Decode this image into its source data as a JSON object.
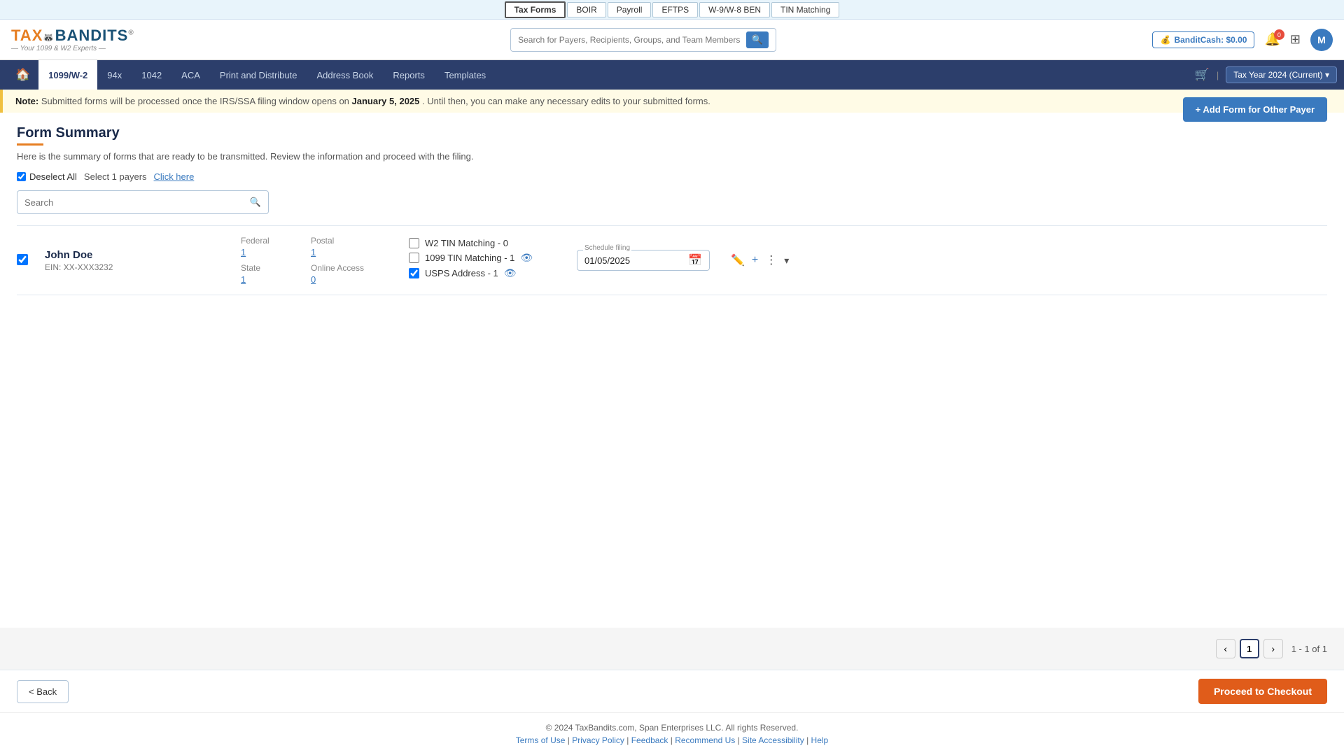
{
  "topbar": {
    "items": [
      {
        "label": "Tax Forms",
        "active": true
      },
      {
        "label": "BOIR",
        "active": false
      },
      {
        "label": "Payroll",
        "active": false
      },
      {
        "label": "EFTPS",
        "active": false
      },
      {
        "label": "W-9/W-8 BEN",
        "active": false
      },
      {
        "label": "TIN Matching",
        "active": false
      }
    ]
  },
  "header": {
    "logo_main": "TAX",
    "logo_brand": "BANDITS",
    "logo_icon": "🦝",
    "logo_reg": "®",
    "logo_sub": "— Your 1099 & W2 Experts —",
    "search_placeholder": "Search for Payers, Recipients, Groups, and Team Members",
    "bandit_cash": "BanditCash: $0.00",
    "notif_count": "0",
    "avatar_label": "M"
  },
  "nav": {
    "items": [
      {
        "label": "1099/W-2",
        "active": true
      },
      {
        "label": "94x",
        "active": false
      },
      {
        "label": "1042",
        "active": false
      },
      {
        "label": "ACA",
        "active": false
      },
      {
        "label": "Print and Distribute",
        "active": false
      },
      {
        "label": "Address Book",
        "active": false
      },
      {
        "label": "Reports",
        "active": false
      },
      {
        "label": "Templates",
        "active": false
      }
    ],
    "tax_year": "Tax Year 2024 (Current) ▾"
  },
  "note": {
    "prefix": "Note:",
    "text": " Submitted forms will be processed once the IRS/SSA filing window opens on ",
    "date": "January 5, 2025",
    "suffix": ". Until then, you can make any necessary edits to your submitted forms."
  },
  "page": {
    "title": "Form Summary",
    "subtitle": "Here is the summary of forms that are ready to be transmitted. Review the information and proceed with the filing.",
    "add_btn": "+ Add Form for Other Payer",
    "deselect_all": "Deselect All",
    "select_payers_text": "Select 1 payers",
    "click_here": "Click here",
    "search_placeholder": "Search"
  },
  "payers": [
    {
      "name": "John Doe",
      "ein": "EIN: XX-XXX3232",
      "federal_label": "Federal",
      "federal_count": "1",
      "state_label": "State",
      "state_count": "1",
      "postal_label": "Postal",
      "postal_count": "1",
      "online_label": "Online Access",
      "online_count": "0",
      "w2_tin_label": "W2 TIN Matching - 0",
      "w2_tin_checked": false,
      "tin1099_label": "1099 TIN Matching - 1",
      "tin1099_checked": false,
      "usps_label": "USPS Address - 1",
      "usps_checked": true,
      "schedule_date": "01/05/2025",
      "schedule_label": "Schedule filing"
    }
  ],
  "pagination": {
    "current_page": "1",
    "page_info": "1 - 1 of 1"
  },
  "actions": {
    "back_label": "< Back",
    "checkout_label": "Proceed to Checkout"
  },
  "footer": {
    "copyright": "© 2024 TaxBandits.com, Span Enterprises LLC. All rights Reserved.",
    "links": [
      {
        "label": "Terms of Use",
        "href": "#"
      },
      {
        "label": "Privacy Policy",
        "href": "#"
      },
      {
        "label": "Feedback",
        "href": "#"
      },
      {
        "label": "Recommend Us",
        "href": "#"
      },
      {
        "label": "Site Accessibility",
        "href": "#"
      },
      {
        "label": "Help",
        "href": "#"
      }
    ]
  }
}
